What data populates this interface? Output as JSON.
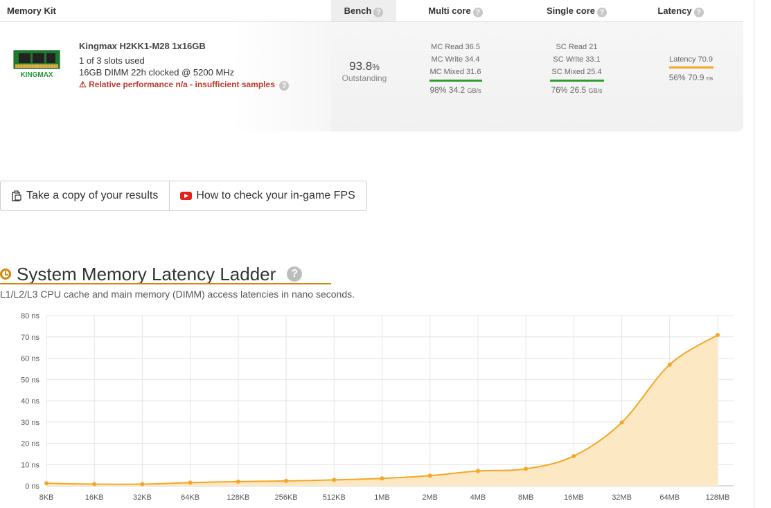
{
  "table": {
    "headers": {
      "kit": "Memory Kit",
      "bench": "Bench",
      "multi": "Multi core",
      "single": "Single core",
      "latency": "Latency"
    },
    "kit": {
      "logo_text": "KINGMAX",
      "name": "Kingmax H2KK1-M28 1x16GB",
      "slots": "1 of 3 slots used",
      "spec": "16GB DIMM 22h clocked @ 5200 MHz",
      "warning": "Relative performance n/a - insufficient samples"
    },
    "bench": {
      "value": "93.8",
      "unit": "%",
      "label": "Outstanding"
    },
    "multi": {
      "lines": [
        "MC Read 36.5",
        "MC Write 34.4",
        "MC Mixed 31.6"
      ],
      "summary": "98% 34.2",
      "unit": "GB/s",
      "bar_color": "#2e9e2e"
    },
    "single": {
      "lines": [
        "SC Read 21",
        "SC Write 33.1",
        "SC Mixed 25.4"
      ],
      "summary": "76% 26.5",
      "unit": "GB/s",
      "bar_color": "#2e9e2e"
    },
    "latency": {
      "line": "Latency 70.9",
      "summary": "56% 70.9",
      "unit": "ns",
      "bar_color": "#f5a623"
    }
  },
  "buttons": {
    "copy": "Take a copy of your results",
    "fps": "How to check your in-game FPS"
  },
  "ladder": {
    "title": "System Memory Latency Ladder",
    "description": "L1/L2/L3 CPU cache and main memory (DIMM) access latencies in nano seconds."
  },
  "chart_data": {
    "type": "area",
    "categories": [
      "8KB",
      "16KB",
      "32KB",
      "64KB",
      "128KB",
      "256KB",
      "512KB",
      "1MB",
      "2MB",
      "4MB",
      "8MB",
      "16MB",
      "32MB",
      "64MB",
      "128MB"
    ],
    "values": [
      1.2,
      0.8,
      0.8,
      1.5,
      2.0,
      2.3,
      2.8,
      3.5,
      4.8,
      7.0,
      8.0,
      14.0,
      29.8,
      57.0,
      70.9
    ],
    "ylim": [
      0,
      80
    ],
    "yticks": [
      0,
      10,
      20,
      30,
      40,
      50,
      60,
      70,
      80
    ],
    "ytick_labels": [
      "0 ns",
      "10 ns",
      "20 ns",
      "30 ns",
      "40 ns",
      "50 ns",
      "60 ns",
      "70 ns",
      "80 ns"
    ],
    "grid": true,
    "line_color": "#f5a623",
    "fill_color": "#fde8c4"
  }
}
